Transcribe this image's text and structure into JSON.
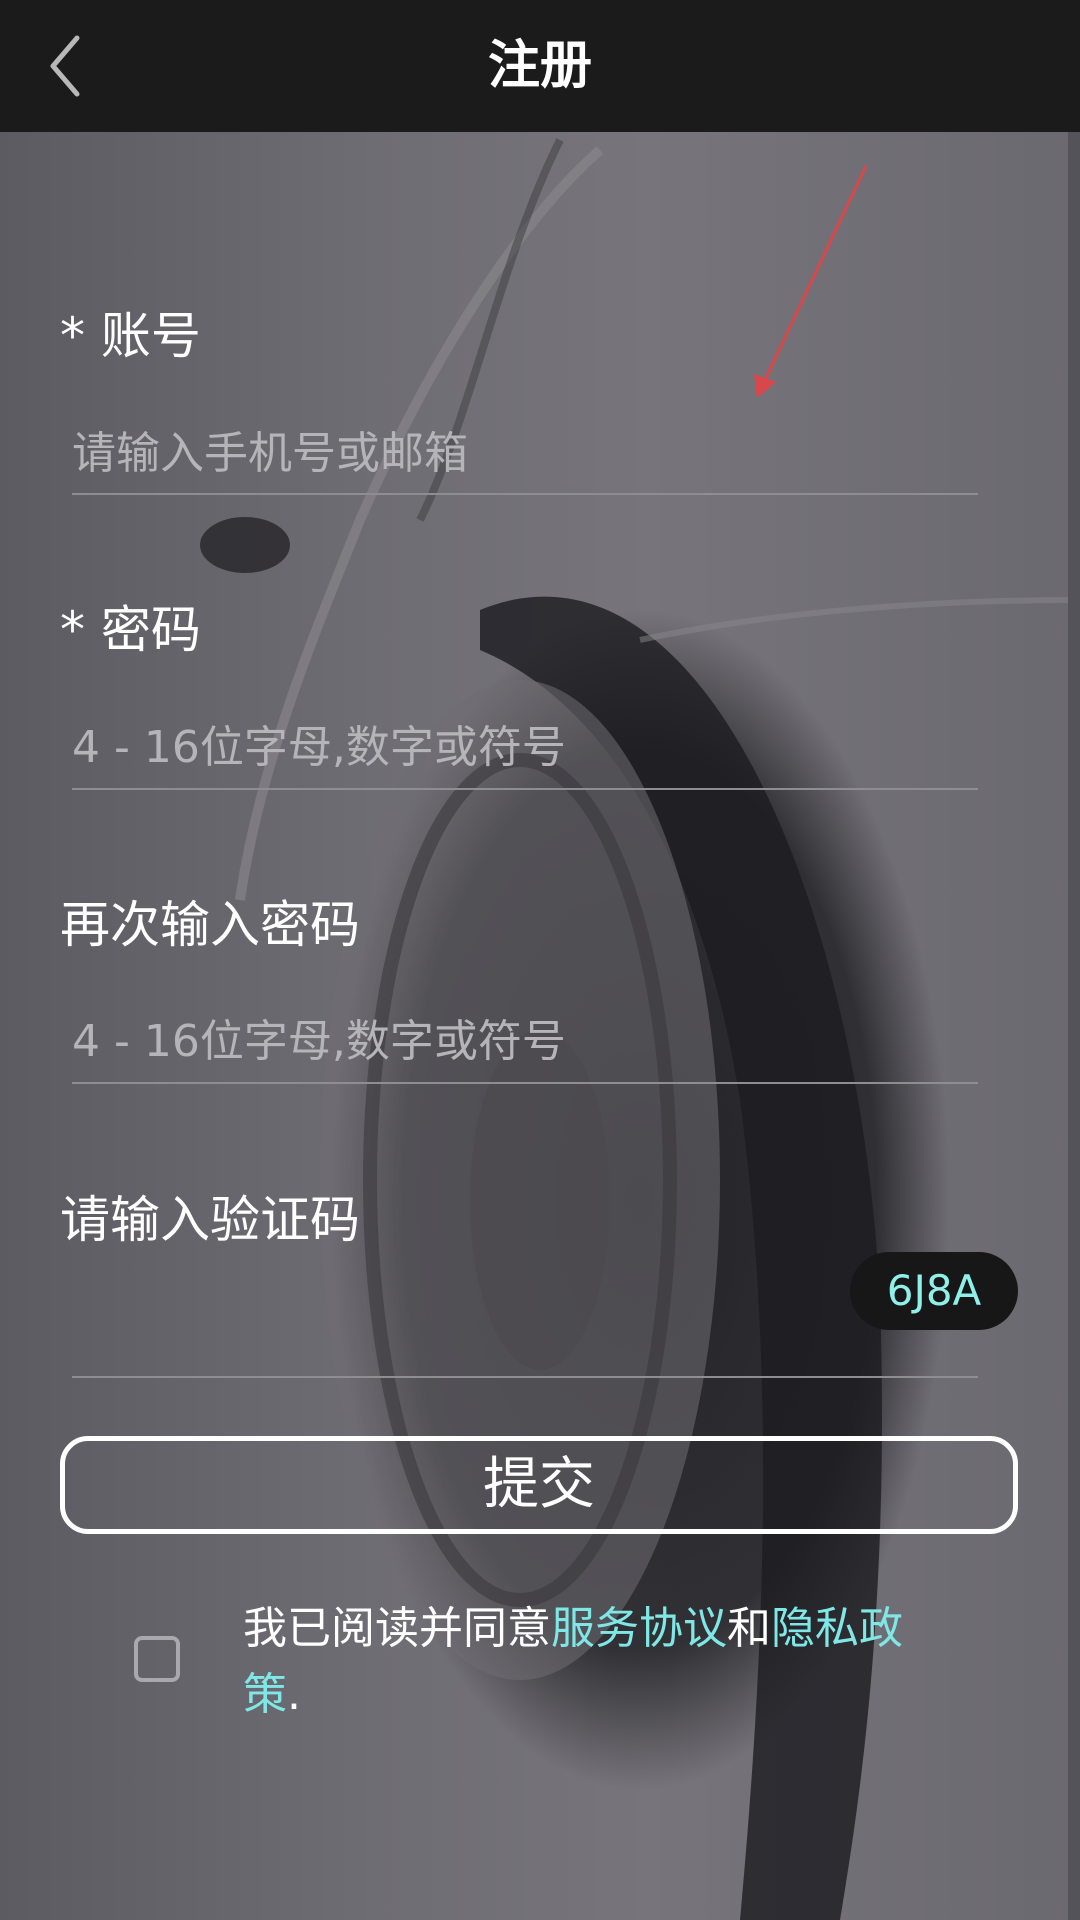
{
  "header": {
    "title": "注册",
    "back_icon": "chevron-left-icon"
  },
  "form": {
    "account": {
      "label": "* 账号",
      "placeholder": "请输入手机号或邮箱",
      "value": ""
    },
    "password": {
      "label": "* 密码",
      "placeholder": "4 - 16位字母,数字或符号",
      "value": ""
    },
    "confirm_password": {
      "label": "再次输入密码",
      "placeholder": "4 - 16位字母,数字或符号",
      "value": ""
    },
    "captcha": {
      "label": "请输入验证码",
      "value": "",
      "code": "6J8A"
    },
    "submit_label": "提交"
  },
  "agreement": {
    "checked": false,
    "prefix": "我已阅读并同意",
    "service_link": "服务协议",
    "and": "和",
    "privacy_link": "隐私政策",
    "suffix": "."
  },
  "colors": {
    "header_bg": "#1b1b1b",
    "link": "#7fe8e6",
    "captcha_text": "#8ff0ea"
  }
}
